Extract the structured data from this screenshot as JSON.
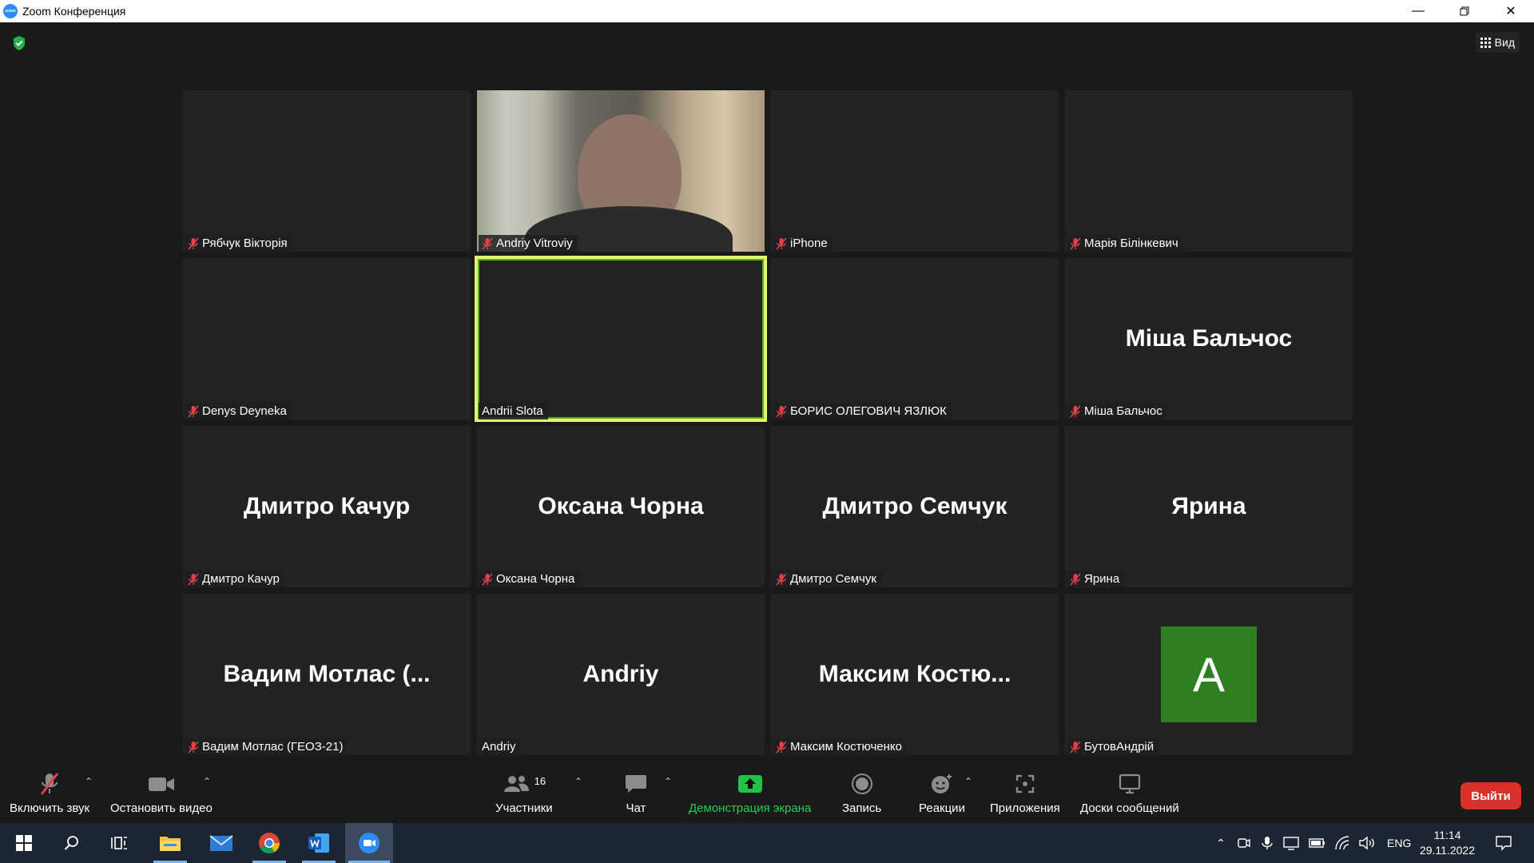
{
  "window": {
    "title": "Zoom Конференция",
    "app_icon_text": "zoom"
  },
  "meeting": {
    "view_label": "Вид"
  },
  "tiles": [
    {
      "label": "Рябчук Вікторія",
      "muted": true
    },
    {
      "label": "Andriy Vitroviy",
      "muted": true,
      "video": true
    },
    {
      "label": "iPhone",
      "muted": true
    },
    {
      "label": "Марія Білінкевич",
      "muted": true
    },
    {
      "label": "Denys Deyneka",
      "muted": true
    },
    {
      "label": "Andrii Slota",
      "muted": false,
      "active_speaker": true
    },
    {
      "label": "БОРИС ОЛЕГОВИЧ ЯЗЛЮК",
      "muted": true
    },
    {
      "label": "Міша Бальчос",
      "center_name": "Міша Бальчос",
      "muted": true
    },
    {
      "label": "Дмитро Качур",
      "center_name": "Дмитро Качур",
      "muted": true
    },
    {
      "label": "Оксана Чорна",
      "center_name": "Оксана Чорна",
      "muted": true
    },
    {
      "label": "Дмитро Семчук",
      "center_name": "Дмитро Семчук",
      "muted": true
    },
    {
      "label": "Ярина",
      "center_name": "Ярина",
      "muted": true
    },
    {
      "label": "Вадим Мотлас (ГЕОЗ-21)",
      "center_name": "Вадим Мотлас (...",
      "muted": true
    },
    {
      "label": "Andriy",
      "center_name": "Andriy",
      "muted": false
    },
    {
      "label": "Максим Костюченко",
      "center_name": "Максим Костю...",
      "muted": true
    },
    {
      "label": "БутовАндрій",
      "avatar_letter": "A",
      "muted": true
    }
  ],
  "toolbar": {
    "unmute": "Включить звук",
    "stop_video": "Остановить видео",
    "participants": "Участники",
    "participants_count": "16",
    "chat": "Чат",
    "share": "Демонстрация экрана",
    "record": "Запись",
    "reactions": "Реакции",
    "apps": "Приложения",
    "whiteboards": "Доски сообщений",
    "leave": "Выйти"
  },
  "taskbar": {
    "language": "ENG",
    "time": "11:14",
    "date": "29.11.2022"
  },
  "colors": {
    "active_speaker": "#e4f46b",
    "leave": "#d9302c",
    "share": "#22d14f",
    "muted": "#e0404a"
  }
}
